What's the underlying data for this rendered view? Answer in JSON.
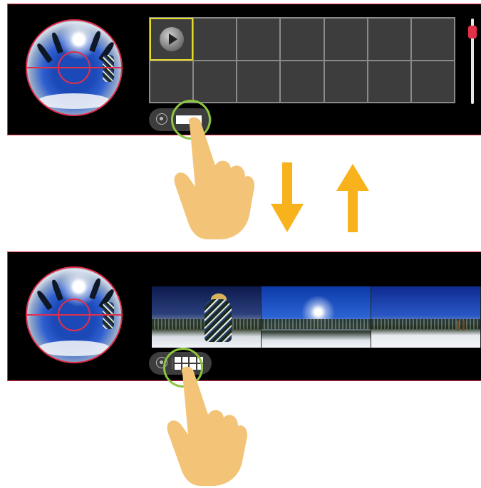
{
  "panels": [
    {
      "view": "grid",
      "view_toggle_state": "bar"
    },
    {
      "view": "filmstrip",
      "view_toggle_state": "grid"
    }
  ],
  "grid": {
    "rows": 2,
    "columns": 7,
    "selected_cell": 1
  },
  "zoom_slider": {
    "level": 0.9
  },
  "arrows": {
    "down_color": "#f8b21c",
    "up_color": "#f8b21c"
  },
  "colors": {
    "accent_red": "#e0304a",
    "highlight_green": "#8cc63f",
    "selection_yellow": "#e6d82a",
    "hand_skin": "#f3c477"
  },
  "icons": [
    "camera-mode-icon",
    "bar-view-icon",
    "grid-view-icon",
    "play-icon",
    "tap-hand-icon",
    "arrow-down-icon",
    "arrow-up-icon"
  ]
}
